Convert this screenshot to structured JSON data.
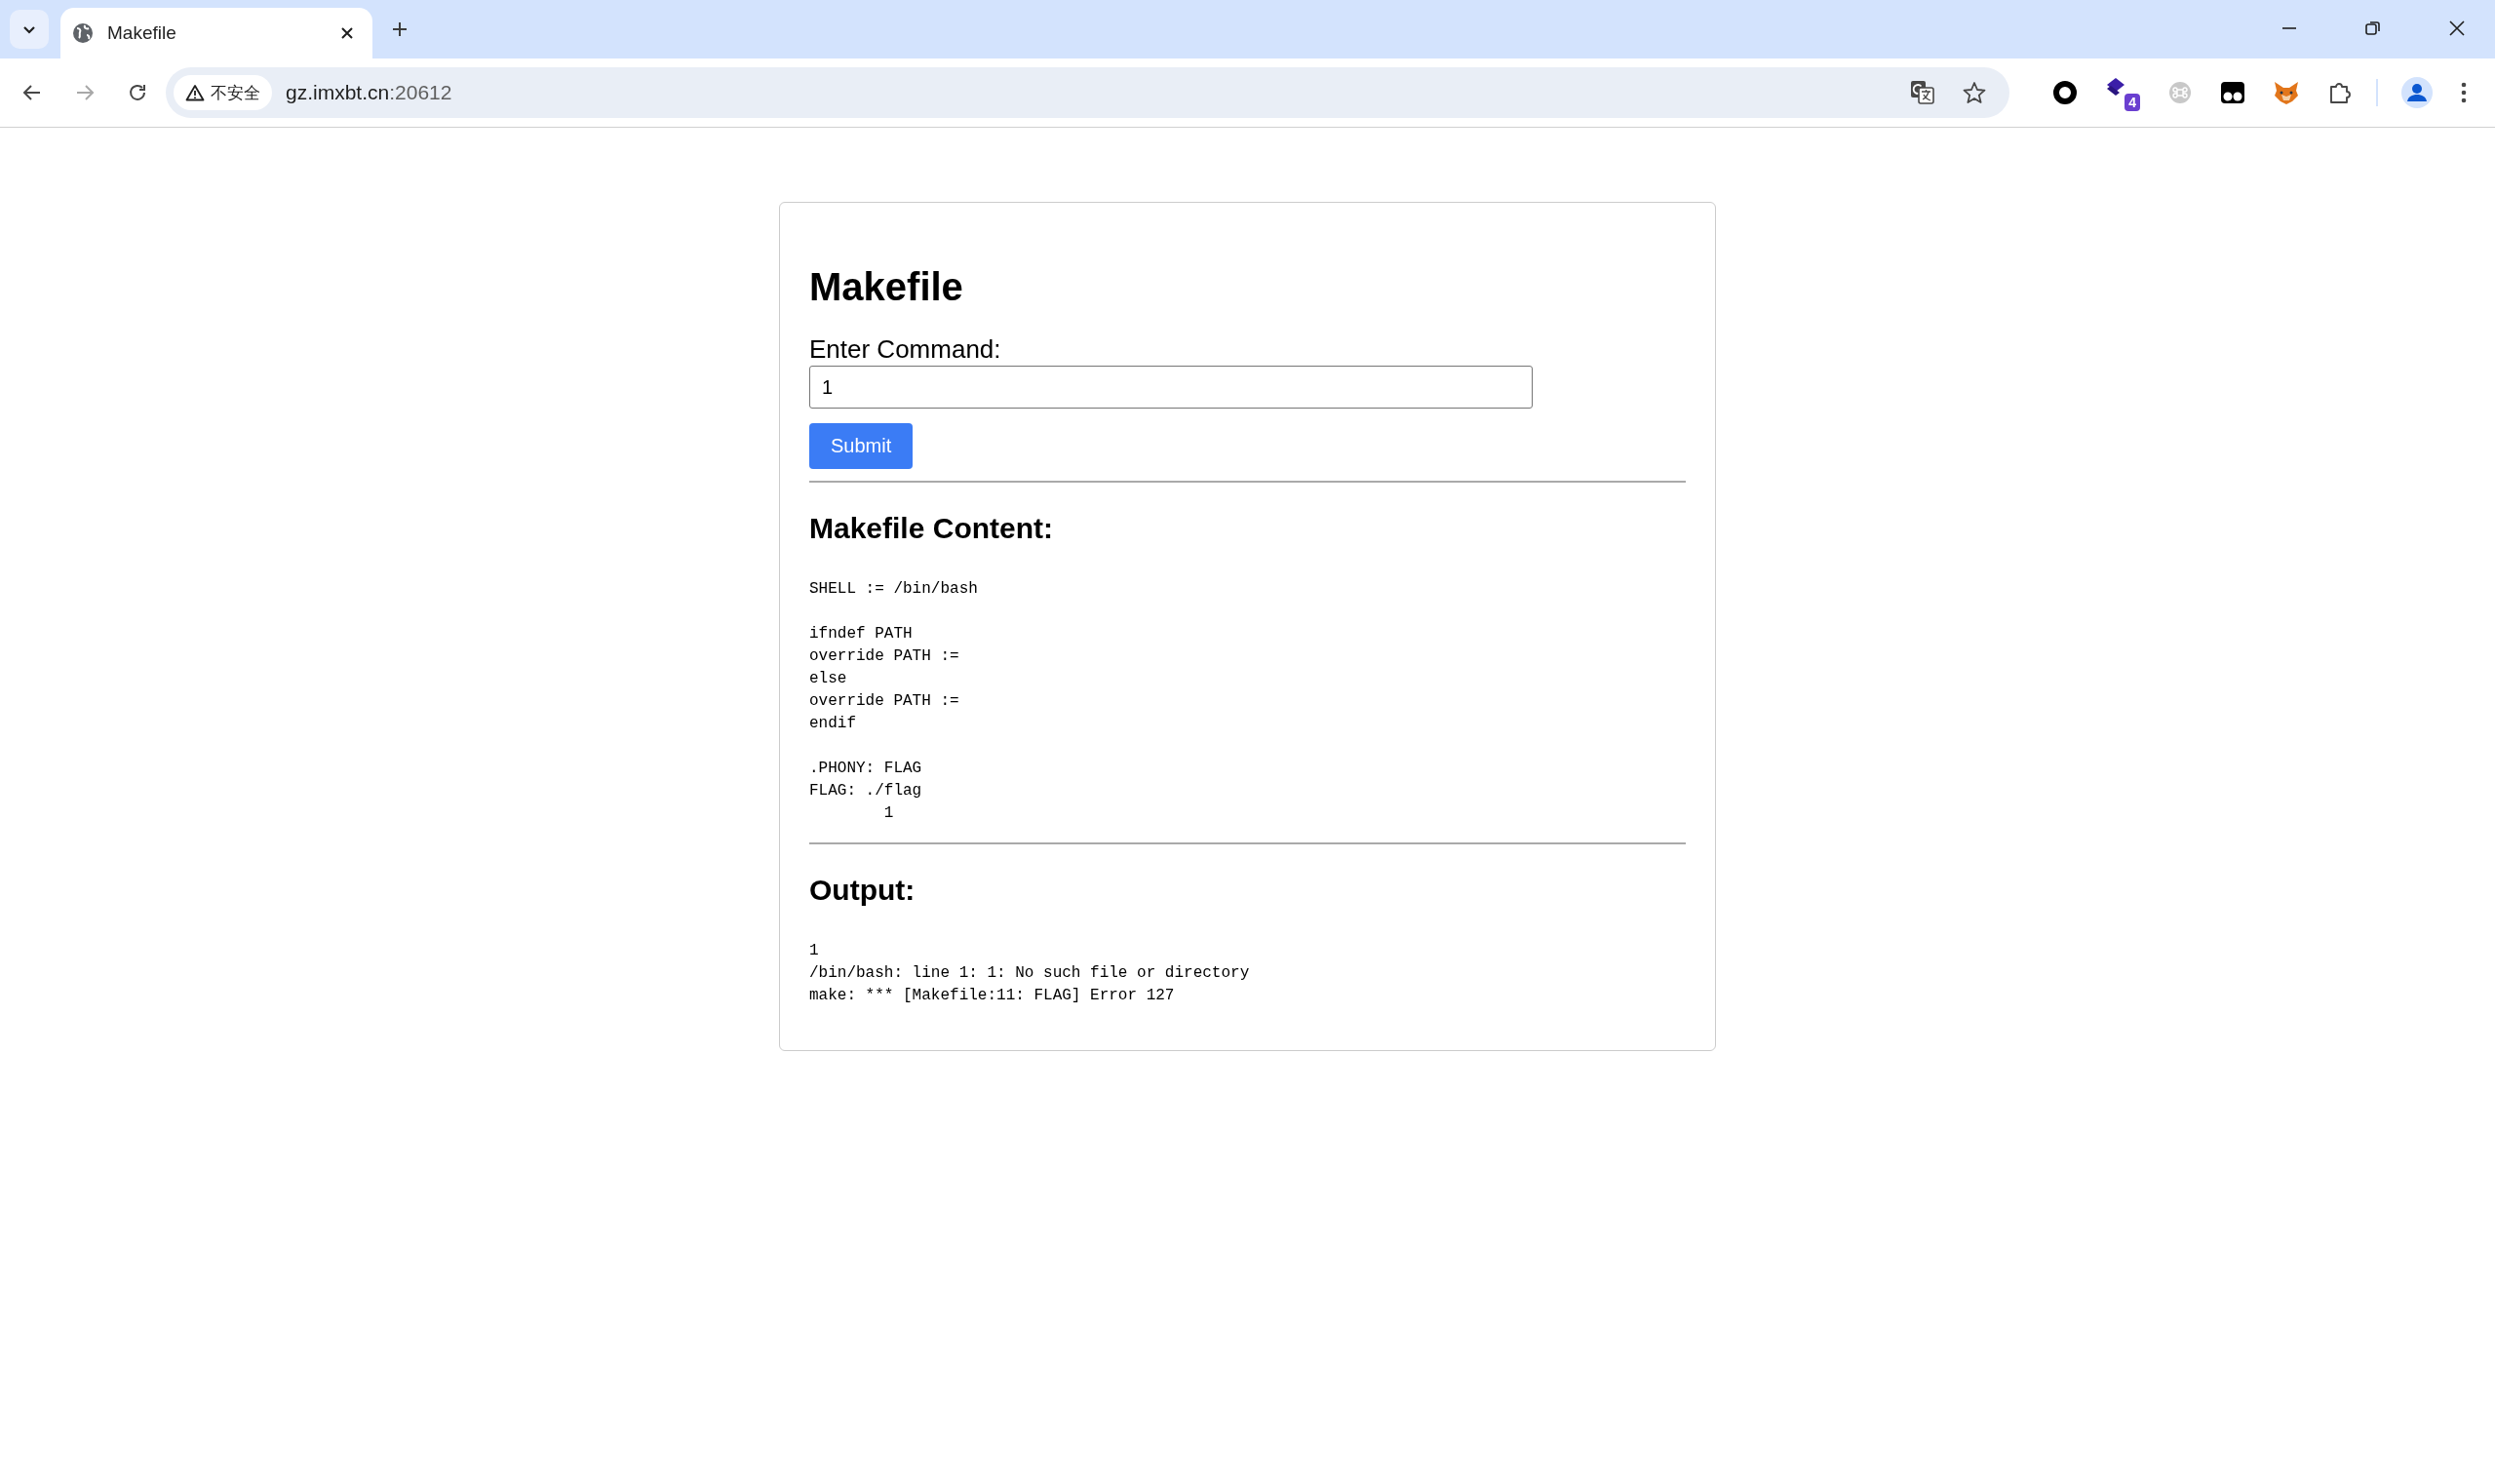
{
  "browser": {
    "tab_title": "Makefile",
    "security_label": "不安全",
    "url_host": "gz.imxbt.cn",
    "url_port": ":20612",
    "extension_badge": "4"
  },
  "page": {
    "title": "Makefile",
    "command_label": "Enter Command:",
    "command_value": "1",
    "submit_label": "Submit",
    "content_heading": "Makefile Content:",
    "makefile_content": "SHELL := /bin/bash\n\nifndef PATH\noverride PATH :=\nelse\noverride PATH :=\nendif\n\n.PHONY: FLAG\nFLAG: ./flag\n\t1",
    "output_heading": "Output:",
    "output": "1\n/bin/bash: line 1: 1: No such file or directory\nmake: *** [Makefile:11: FLAG] Error 127"
  }
}
